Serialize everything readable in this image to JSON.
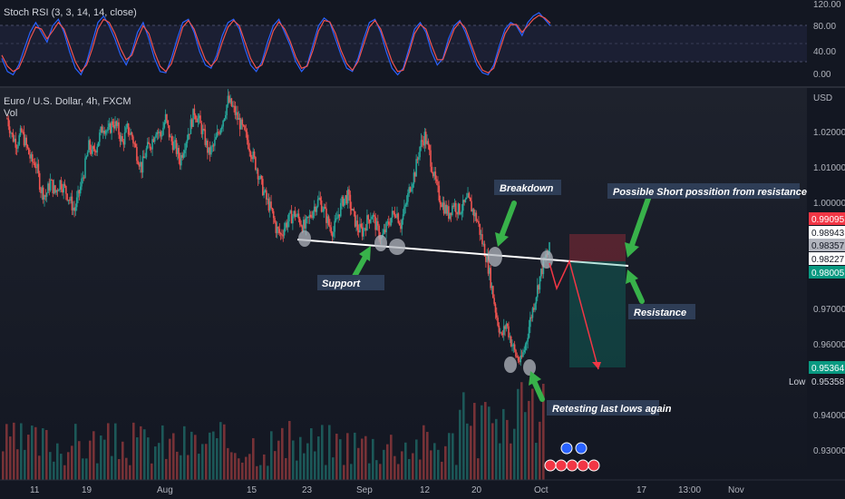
{
  "chart_data": [
    {
      "type": "line",
      "title": "Stoch RSI (3, 3, 14, 14, close)",
      "yticks": [
        "120.00",
        "80.00",
        "40.00",
        "0.00"
      ],
      "ylim": [
        -10,
        120
      ],
      "bands": [
        20,
        50,
        80
      ],
      "series": [
        {
          "color": "#2962ff",
          "values": [
            30,
            10,
            5,
            20,
            45,
            70,
            85,
            70,
            55,
            80,
            90,
            70,
            40,
            15,
            5,
            25,
            55,
            85,
            95,
            80,
            60,
            35,
            20,
            40,
            70,
            85,
            60,
            30,
            10,
            8,
            30,
            60,
            85,
            90,
            70,
            40,
            20,
            15,
            35,
            65,
            85,
            90,
            75,
            45,
            20,
            10,
            25,
            55,
            80,
            90,
            70,
            50,
            25,
            10,
            20,
            50,
            80,
            92,
            85,
            60,
            35,
            15,
            10,
            30,
            60,
            85,
            90,
            70,
            40,
            15,
            5,
            15,
            45,
            75,
            85,
            70,
            40,
            20,
            30,
            60,
            80,
            88,
            70,
            45,
            20,
            8,
            5,
            20,
            50,
            75,
            85,
            80,
            65,
            85,
            95,
            100,
            90,
            80
          ]
        },
        {
          "color": "#ef5350",
          "values": [
            35,
            18,
            10,
            15,
            35,
            60,
            78,
            75,
            60,
            72,
            85,
            75,
            50,
            25,
            10,
            20,
            45,
            75,
            90,
            85,
            68,
            45,
            28,
            35,
            60,
            80,
            68,
            40,
            18,
            10,
            22,
            50,
            78,
            88,
            75,
            50,
            28,
            18,
            28,
            55,
            78,
            88,
            80,
            55,
            30,
            15,
            20,
            45,
            72,
            86,
            75,
            56,
            32,
            15,
            18,
            42,
            72,
            88,
            86,
            68,
            42,
            22,
            12,
            25,
            52,
            78,
            88,
            75,
            50,
            25,
            10,
            12,
            38,
            68,
            82,
            75,
            50,
            28,
            28,
            52,
            75,
            86,
            76,
            52,
            28,
            12,
            8,
            15,
            42,
            68,
            82,
            82,
            70,
            80,
            90,
            96,
            92,
            84
          ]
        }
      ]
    },
    {
      "type": "line",
      "title": "Euro / U.S. Dollar, 4h, FXCM",
      "subtitle": "Vol",
      "unit_label": "USD",
      "ylim": [
        0.922,
        1.04
      ],
      "yticks": [
        "1.02000",
        "1.01000",
        "1.00000",
        "0.97000",
        "0.96000",
        "0.94000",
        "0.93000"
      ],
      "xticks": [
        "11",
        "19",
        "Aug",
        "15",
        "23",
        "Sep",
        "12",
        "20",
        "Oct",
        "17",
        "13:00",
        "Nov"
      ],
      "price_tags": [
        {
          "value": "0.99095",
          "bg": "#f23645",
          "fg": "#ffffff"
        },
        {
          "value": "0.98943",
          "bg": "#ffffff",
          "fg": "#131722"
        },
        {
          "value": "0.98357",
          "bg": "#b2b5be",
          "fg": "#131722"
        },
        {
          "value": "0.98227",
          "bg": "#ffffff",
          "fg": "#131722"
        },
        {
          "value": "0.98005",
          "bg": "#089981",
          "fg": "#ffffff"
        },
        {
          "value": "0.95364",
          "bg": "#089981",
          "fg": "#ffffff"
        },
        {
          "value": "0.95358",
          "bg": "#131722",
          "fg": "#d1d4dc"
        }
      ],
      "low_label": "Low",
      "price_path": [
        1.024,
        1.019,
        1.017,
        1.02,
        1.016,
        1.012,
        1.011,
        1.004,
        1.002,
        1.006,
        1.003,
        1.006,
        1.004,
        1.001,
        0.998,
        1.003,
        1.009,
        1.016,
        1.014,
        1.018,
        1.022,
        1.02,
        1.023,
        1.021,
        1.017,
        1.021,
        1.019,
        1.014,
        1.01,
        1.015,
        1.017,
        1.021,
        1.019,
        1.024,
        1.018,
        1.016,
        1.012,
        1.017,
        1.021,
        1.026,
        1.023,
        1.019,
        1.014,
        1.016,
        1.02,
        1.024,
        1.029,
        1.027,
        1.024,
        1.021,
        1.018,
        1.014,
        1.01,
        1.005,
        1.001,
        0.998,
        0.993,
        0.991,
        0.994,
        0.996,
        0.997,
        0.995,
        0.993,
        0.996,
        0.999,
        1.001,
        0.998,
        0.994,
        0.992,
        0.997,
        1.001,
        1.002,
        0.997,
        0.993,
        0.992,
        0.995,
        0.997,
        0.993,
        0.99,
        0.993,
        0.996,
        0.998,
        0.994,
        0.999,
        1.005,
        1.009,
        1.016,
        1.019,
        1.014,
        1.007,
        1.002,
        0.999,
        0.997,
        1.0,
        0.998,
        0.999,
        1.001,
        0.998,
        0.995,
        0.989,
        0.984,
        0.976,
        0.968,
        0.962,
        0.966,
        0.961,
        0.957,
        0.955,
        0.96,
        0.967,
        0.973,
        0.979,
        0.984,
        0.987
      ]
    }
  ],
  "annotations": {
    "support": "Support",
    "breakdown": "Breakdown",
    "short_note": "Possible Short possition from resistance zone",
    "resistance": "Resistance",
    "retest": "Retesting last lows again"
  },
  "colors": {
    "background": "#131722",
    "bull": "#26a69a",
    "bear": "#ef5350",
    "annotation_box": "#2e3d56",
    "arrow": "#38b24a"
  }
}
